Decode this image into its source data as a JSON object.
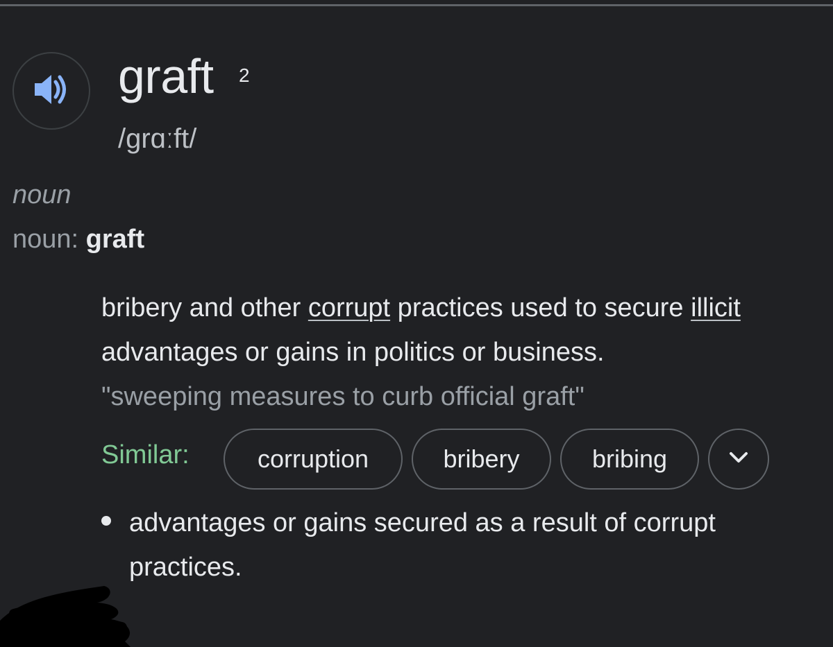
{
  "entry": {
    "headword": "graft",
    "homograph": "2",
    "pronunciation": "/grɑːft/",
    "pos_italic": "noun",
    "pos_label": "noun:",
    "pos_word": "graft"
  },
  "definition": {
    "part1": "bribery and other ",
    "link1": "corrupt",
    "part2": " practices used to secure ",
    "link2": "illicit",
    "part3": " advantages or gains in politics or business.",
    "example": "\"sweeping measures to curb official graft\""
  },
  "similar": {
    "label": "Similar:",
    "chips": [
      "corruption",
      "bribery",
      "bribing"
    ]
  },
  "sense2": {
    "text": "advantages or gains secured as a result of corrupt practices."
  },
  "icons": {
    "speaker": "speaker-icon",
    "expand": "chevron-down-icon"
  },
  "colors": {
    "background": "#202124",
    "text": "#e8eaed",
    "muted": "#9aa0a6",
    "similar_label": "#81c995",
    "speaker_icon": "#8ab4f8",
    "chip_border": "#5f6368"
  }
}
